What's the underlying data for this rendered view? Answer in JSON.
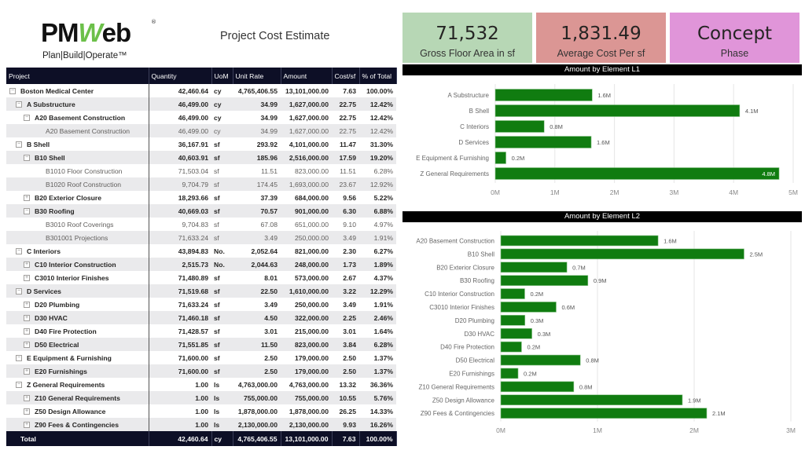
{
  "header": {
    "logo_text_pm": "PM",
    "logo_text_w": "W",
    "logo_text_eb": "eb",
    "logo_registered": "®",
    "logo_tagline": "Plan|Build|Operate™",
    "report_title": "Project Cost Estimate"
  },
  "kpis": [
    {
      "value": "71,532",
      "label": "Gross Floor Area in sf",
      "color": "#b7d7b5"
    },
    {
      "value": "1,831.49",
      "label": "Average Cost Per sf",
      "color": "#db9694"
    },
    {
      "value": "Concept",
      "label": "Phase",
      "color": "#e095d9"
    }
  ],
  "table": {
    "columns": [
      "Project",
      "Quantity",
      "UoM",
      "Unit Rate",
      "Amount",
      "Cost/sf",
      "% of Total"
    ],
    "rows": [
      {
        "level": 0,
        "toggle": "−",
        "style": "bold",
        "name": "Boston Medical Center",
        "qty": "42,460.64",
        "uom": "cy",
        "rate": "4,765,406.55",
        "amount": "13,101,000.00",
        "costsf": "7.63",
        "pct": "100.00%"
      },
      {
        "level": 1,
        "toggle": "−",
        "style": "bold",
        "name": "A Substructure",
        "qty": "46,499.00",
        "uom": "cy",
        "rate": "34.99",
        "amount": "1,627,000.00",
        "costsf": "22.75",
        "pct": "12.42%"
      },
      {
        "level": 2,
        "toggle": "−",
        "style": "bold",
        "name": "A20 Basement Construction",
        "qty": "46,499.00",
        "uom": "cy",
        "rate": "34.99",
        "amount": "1,627,000.00",
        "costsf": "22.75",
        "pct": "12.42%"
      },
      {
        "level": 3,
        "toggle": "",
        "style": "leaf",
        "name": "A20 Basement Construction",
        "qty": "46,499.00",
        "uom": "cy",
        "rate": "34.99",
        "amount": "1,627,000.00",
        "costsf": "22.75",
        "pct": "12.42%"
      },
      {
        "level": 1,
        "toggle": "−",
        "style": "bold",
        "name": "B Shell",
        "qty": "36,167.91",
        "uom": "sf",
        "rate": "293.92",
        "amount": "4,101,000.00",
        "costsf": "11.47",
        "pct": "31.30%"
      },
      {
        "level": 2,
        "toggle": "−",
        "style": "bold",
        "name": "B10 Shell",
        "qty": "40,603.91",
        "uom": "sf",
        "rate": "185.96",
        "amount": "2,516,000.00",
        "costsf": "17.59",
        "pct": "19.20%"
      },
      {
        "level": 3,
        "toggle": "",
        "style": "leaf",
        "name": "B1010 Floor Construction",
        "qty": "71,503.04",
        "uom": "sf",
        "rate": "11.51",
        "amount": "823,000.00",
        "costsf": "11.51",
        "pct": "6.28%"
      },
      {
        "level": 3,
        "toggle": "",
        "style": "leaf",
        "name": "B1020 Roof Construction",
        "qty": "9,704.79",
        "uom": "sf",
        "rate": "174.45",
        "amount": "1,693,000.00",
        "costsf": "23.67",
        "pct": "12.92%"
      },
      {
        "level": 2,
        "toggle": "+",
        "style": "bold",
        "name": "B20 Exterior Closure",
        "qty": "18,293.66",
        "uom": "sf",
        "rate": "37.39",
        "amount": "684,000.00",
        "costsf": "9.56",
        "pct": "5.22%"
      },
      {
        "level": 2,
        "toggle": "−",
        "style": "bold",
        "name": "B30 Roofing",
        "qty": "40,669.03",
        "uom": "sf",
        "rate": "70.57",
        "amount": "901,000.00",
        "costsf": "6.30",
        "pct": "6.88%"
      },
      {
        "level": 3,
        "toggle": "",
        "style": "leaf",
        "name": "B3010 Roof Coverings",
        "qty": "9,704.83",
        "uom": "sf",
        "rate": "67.08",
        "amount": "651,000.00",
        "costsf": "9.10",
        "pct": "4.97%"
      },
      {
        "level": 3,
        "toggle": "",
        "style": "leaf",
        "name": "B301001 Projections",
        "qty": "71,633.24",
        "uom": "sf",
        "rate": "3.49",
        "amount": "250,000.00",
        "costsf": "3.49",
        "pct": "1.91%"
      },
      {
        "level": 1,
        "toggle": "−",
        "style": "bold",
        "name": "C Interiors",
        "qty": "43,894.83",
        "uom": "No.",
        "rate": "2,052.64",
        "amount": "821,000.00",
        "costsf": "2.30",
        "pct": "6.27%"
      },
      {
        "level": 2,
        "toggle": "+",
        "style": "bold",
        "name": "C10 Interior Construction",
        "qty": "2,515.73",
        "uom": "No.",
        "rate": "2,044.63",
        "amount": "248,000.00",
        "costsf": "1.73",
        "pct": "1.89%"
      },
      {
        "level": 2,
        "toggle": "+",
        "style": "bold",
        "name": "C3010 Interior Finishes",
        "qty": "71,480.89",
        "uom": "sf",
        "rate": "8.01",
        "amount": "573,000.00",
        "costsf": "2.67",
        "pct": "4.37%"
      },
      {
        "level": 1,
        "toggle": "−",
        "style": "bold",
        "name": "D Services",
        "qty": "71,519.68",
        "uom": "sf",
        "rate": "22.50",
        "amount": "1,610,000.00",
        "costsf": "3.22",
        "pct": "12.29%"
      },
      {
        "level": 2,
        "toggle": "+",
        "style": "bold",
        "name": "D20 Plumbing",
        "qty": "71,633.24",
        "uom": "sf",
        "rate": "3.49",
        "amount": "250,000.00",
        "costsf": "3.49",
        "pct": "1.91%"
      },
      {
        "level": 2,
        "toggle": "+",
        "style": "bold",
        "name": "D30 HVAC",
        "qty": "71,460.18",
        "uom": "sf",
        "rate": "4.50",
        "amount": "322,000.00",
        "costsf": "2.25",
        "pct": "2.46%"
      },
      {
        "level": 2,
        "toggle": "+",
        "style": "bold",
        "name": "D40 Fire Protection",
        "qty": "71,428.57",
        "uom": "sf",
        "rate": "3.01",
        "amount": "215,000.00",
        "costsf": "3.01",
        "pct": "1.64%"
      },
      {
        "level": 2,
        "toggle": "+",
        "style": "bold",
        "name": "D50 Electrical",
        "qty": "71,551.85",
        "uom": "sf",
        "rate": "11.50",
        "amount": "823,000.00",
        "costsf": "3.84",
        "pct": "6.28%"
      },
      {
        "level": 1,
        "toggle": "−",
        "style": "bold",
        "name": "E Equipment & Furnishing",
        "qty": "71,600.00",
        "uom": "sf",
        "rate": "2.50",
        "amount": "179,000.00",
        "costsf": "2.50",
        "pct": "1.37%"
      },
      {
        "level": 2,
        "toggle": "+",
        "style": "bold",
        "name": "E20 Furnishings",
        "qty": "71,600.00",
        "uom": "sf",
        "rate": "2.50",
        "amount": "179,000.00",
        "costsf": "2.50",
        "pct": "1.37%"
      },
      {
        "level": 1,
        "toggle": "−",
        "style": "bold",
        "name": "Z General Requirements",
        "qty": "1.00",
        "uom": "ls",
        "rate": "4,763,000.00",
        "amount": "4,763,000.00",
        "costsf": "13.32",
        "pct": "36.36%"
      },
      {
        "level": 2,
        "toggle": "+",
        "style": "bold",
        "name": "Z10 General Requirements",
        "qty": "1.00",
        "uom": "ls",
        "rate": "755,000.00",
        "amount": "755,000.00",
        "costsf": "10.55",
        "pct": "5.76%"
      },
      {
        "level": 2,
        "toggle": "+",
        "style": "bold",
        "name": "Z50 Design Allowance",
        "qty": "1.00",
        "uom": "ls",
        "rate": "1,878,000.00",
        "amount": "1,878,000.00",
        "costsf": "26.25",
        "pct": "14.33%"
      },
      {
        "level": 2,
        "toggle": "+",
        "style": "bold",
        "name": "Z90 Fees & Contingencies",
        "qty": "1.00",
        "uom": "ls",
        "rate": "2,130,000.00",
        "amount": "2,130,000.00",
        "costsf": "9.93",
        "pct": "16.26%"
      }
    ],
    "total": {
      "name": "Total",
      "qty": "42,460.64",
      "uom": "cy",
      "rate": "4,765,406.55",
      "amount": "13,101,000.00",
      "costsf": "7.63",
      "pct": "100.00%"
    }
  },
  "chart_data": [
    {
      "type": "bar",
      "orientation": "horizontal",
      "title": "Amount by Element L1",
      "categories": [
        "A Substructure",
        "B Shell",
        "C Interiors",
        "D Services",
        "E Equipment & Furnishing",
        "Z General Requirements"
      ],
      "values": [
        1627000,
        4101000,
        821000,
        1610000,
        179000,
        4763000
      ],
      "labels": [
        "1.6M",
        "4.1M",
        "0.8M",
        "1.6M",
        "0.2M",
        "4.8M"
      ],
      "xlim": [
        0,
        5000000
      ],
      "xticks": [
        "0M",
        "1M",
        "2M",
        "3M",
        "4M",
        "5M"
      ],
      "xlabel": "",
      "ylabel": "",
      "grid": true,
      "color": "#107c10"
    },
    {
      "type": "bar",
      "orientation": "horizontal",
      "title": "Amount by Element L2",
      "categories": [
        "A20 Basement Construction",
        "B10 Shell",
        "B20 Exterior Closure",
        "B30 Roofing",
        "C10 Interior Construction",
        "C3010 Interior Finishes",
        "D20 Plumbing",
        "D30 HVAC",
        "D40 Fire Protection",
        "D50 Electrical",
        "E20 Furnishings",
        "Z10 General Requirements",
        "Z50 Design Allowance",
        "Z90 Fees & Contingencies"
      ],
      "values": [
        1627000,
        2516000,
        684000,
        901000,
        248000,
        573000,
        250000,
        322000,
        215000,
        823000,
        179000,
        755000,
        1878000,
        2130000
      ],
      "labels": [
        "1.6M",
        "2.5M",
        "0.7M",
        "0.9M",
        "0.2M",
        "0.6M",
        "0.3M",
        "0.3M",
        "0.2M",
        "0.8M",
        "0.2M",
        "0.8M",
        "1.9M",
        "2.1M"
      ],
      "xlim": [
        0,
        3000000
      ],
      "xticks": [
        "0M",
        "1M",
        "2M",
        "3M"
      ],
      "xlabel": "",
      "ylabel": "",
      "grid": true,
      "color": "#107c10"
    }
  ]
}
